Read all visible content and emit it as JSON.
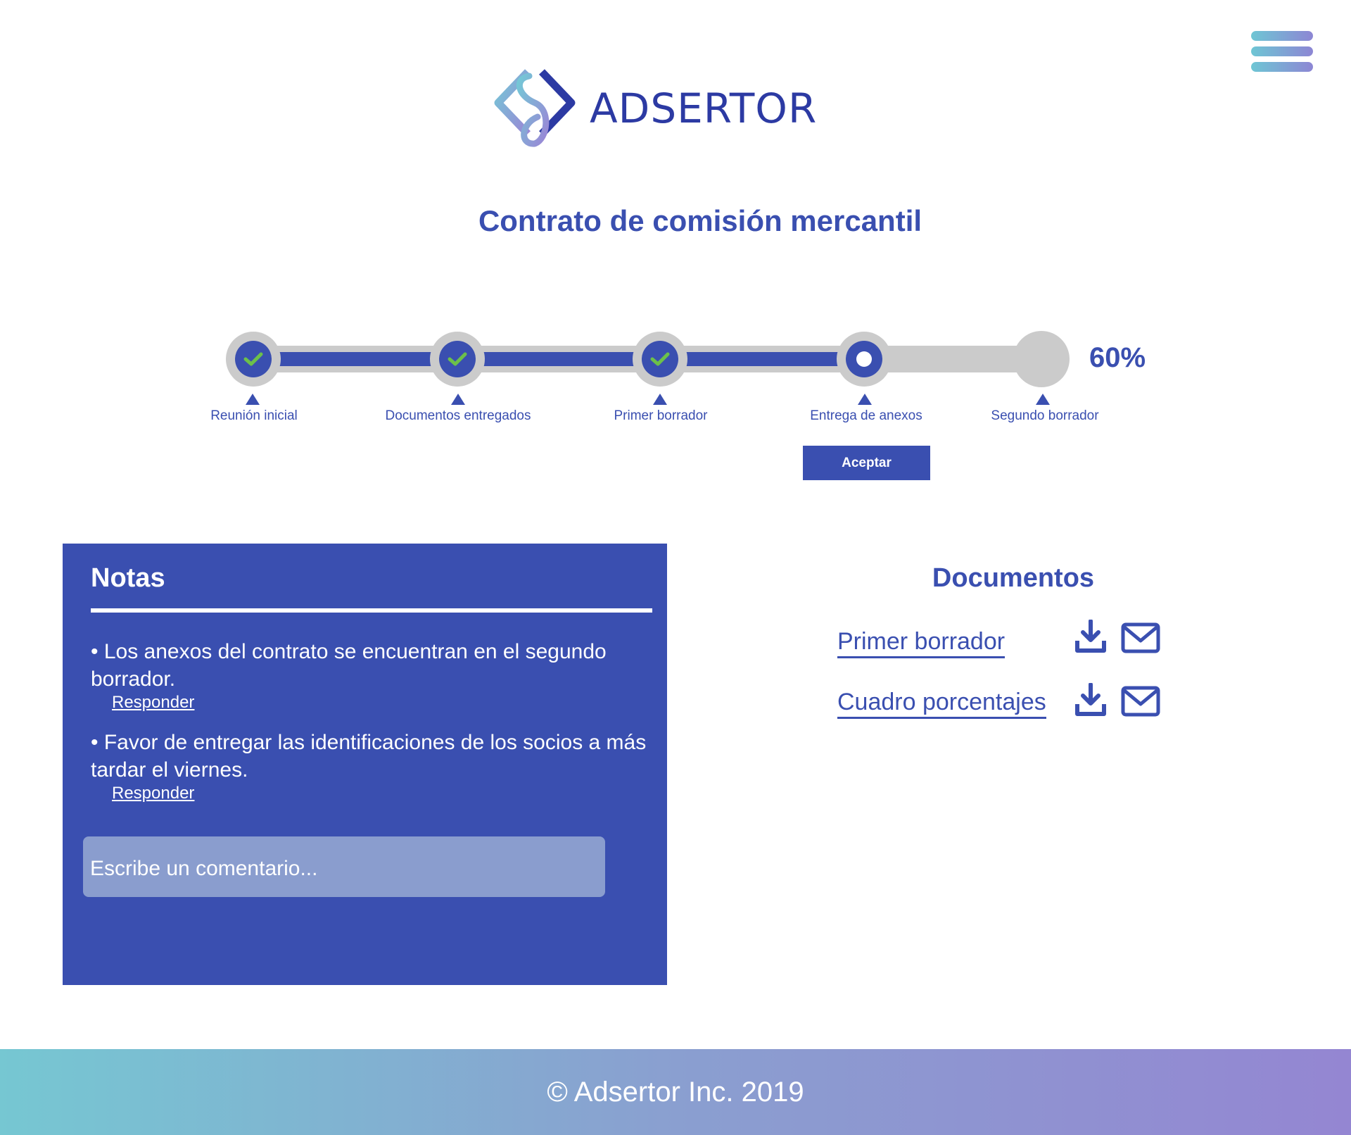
{
  "header": {
    "brand": "ADSERTOR",
    "menu_icon": "hamburger-menu-icon"
  },
  "page": {
    "title": "Contrato de comisión mercantil"
  },
  "progress": {
    "percent_label": "60%",
    "percent_value": 60,
    "steps": [
      {
        "label": "Reunión inicial",
        "status": "done"
      },
      {
        "label": "Documentos entregados",
        "status": "done"
      },
      {
        "label": "Primer borrador",
        "status": "done"
      },
      {
        "label": "Entrega de anexos",
        "status": "current"
      },
      {
        "label": "Segundo borrador",
        "status": "pending"
      }
    ],
    "accept_label": "Aceptar"
  },
  "notes": {
    "title": "Notas",
    "items": [
      {
        "text": "• Los anexos del contrato se encuentran en el segundo borrador.",
        "reply_label": "Responder"
      },
      {
        "text": "• Favor de entregar las identificaciones de los socios a más tardar el viernes.",
        "reply_label": "Responder"
      }
    ],
    "comment_placeholder": "Escribe un comentario..."
  },
  "documents": {
    "title": "Documentos",
    "items": [
      {
        "name": "Primer borrador",
        "download_icon": "download-icon",
        "email_icon": "envelope-icon"
      },
      {
        "name": "Cuadro porcentajes",
        "download_icon": "download-icon",
        "email_icon": "envelope-icon"
      }
    ]
  },
  "footer": {
    "text": "© Adsertor Inc. 2019"
  },
  "colors": {
    "primary": "#3a4fb0",
    "check": "#6cc04a",
    "track": "#cbcbcb",
    "footer_gradient_start": "#76c7d2",
    "footer_gradient_end": "#9486d2"
  }
}
